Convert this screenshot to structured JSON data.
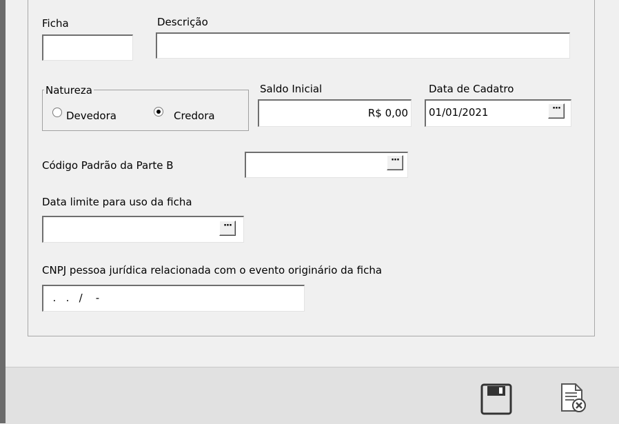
{
  "form": {
    "ficha_label": "Ficha",
    "ficha_value": "",
    "descricao_label": "Descrição",
    "descricao_value": "",
    "natureza_label": "Natureza",
    "natureza_options": [
      "Devedora",
      "Credora"
    ],
    "natureza_selected": "Credora",
    "saldo_label": "Saldo Inicial",
    "saldo_value": "R$ 0,00",
    "data_cadastro_label": "Data de Cadatro",
    "data_cadastro_value": "01/01/2021",
    "codigo_label": "Código Padrão da Parte B",
    "codigo_value": "",
    "data_limite_label": "Data limite para uso da ficha",
    "data_limite_value": "",
    "cnpj_label": "CNPJ pessoa jurídica relacionada com o evento originário da ficha",
    "cnpj_value": "  .   .   /    -"
  },
  "buttons": {
    "browse_label": "···"
  },
  "toolbar": {
    "save_icon": "floppy-disk",
    "cancel_icon": "document-cancel"
  }
}
